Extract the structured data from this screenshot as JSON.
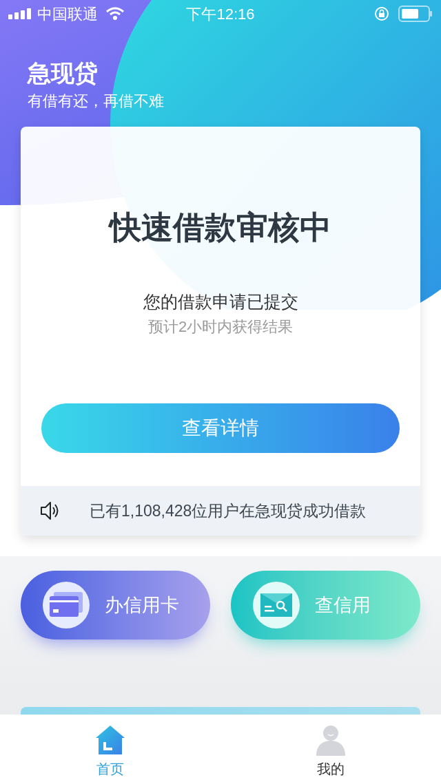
{
  "status_bar": {
    "carrier": "中国联通",
    "time": "下午12:16"
  },
  "header": {
    "title": "急现贷",
    "subtitle": "有借有还，再借不难"
  },
  "status_card": {
    "title": "快速借款审核中",
    "message": "您的借款申请已提交",
    "hint": "预计2小时内获得结果",
    "button": "查看详情",
    "notice": "已有1,108,428位用户在急现贷成功借款"
  },
  "quick_actions": [
    {
      "kind": "card",
      "label": "办信用卡"
    },
    {
      "kind": "credit",
      "label": "查信用"
    }
  ],
  "tab_bar": [
    {
      "kind": "home",
      "label": "首页",
      "selected": true
    },
    {
      "kind": "profile",
      "label": "我的",
      "selected": false
    }
  ]
}
